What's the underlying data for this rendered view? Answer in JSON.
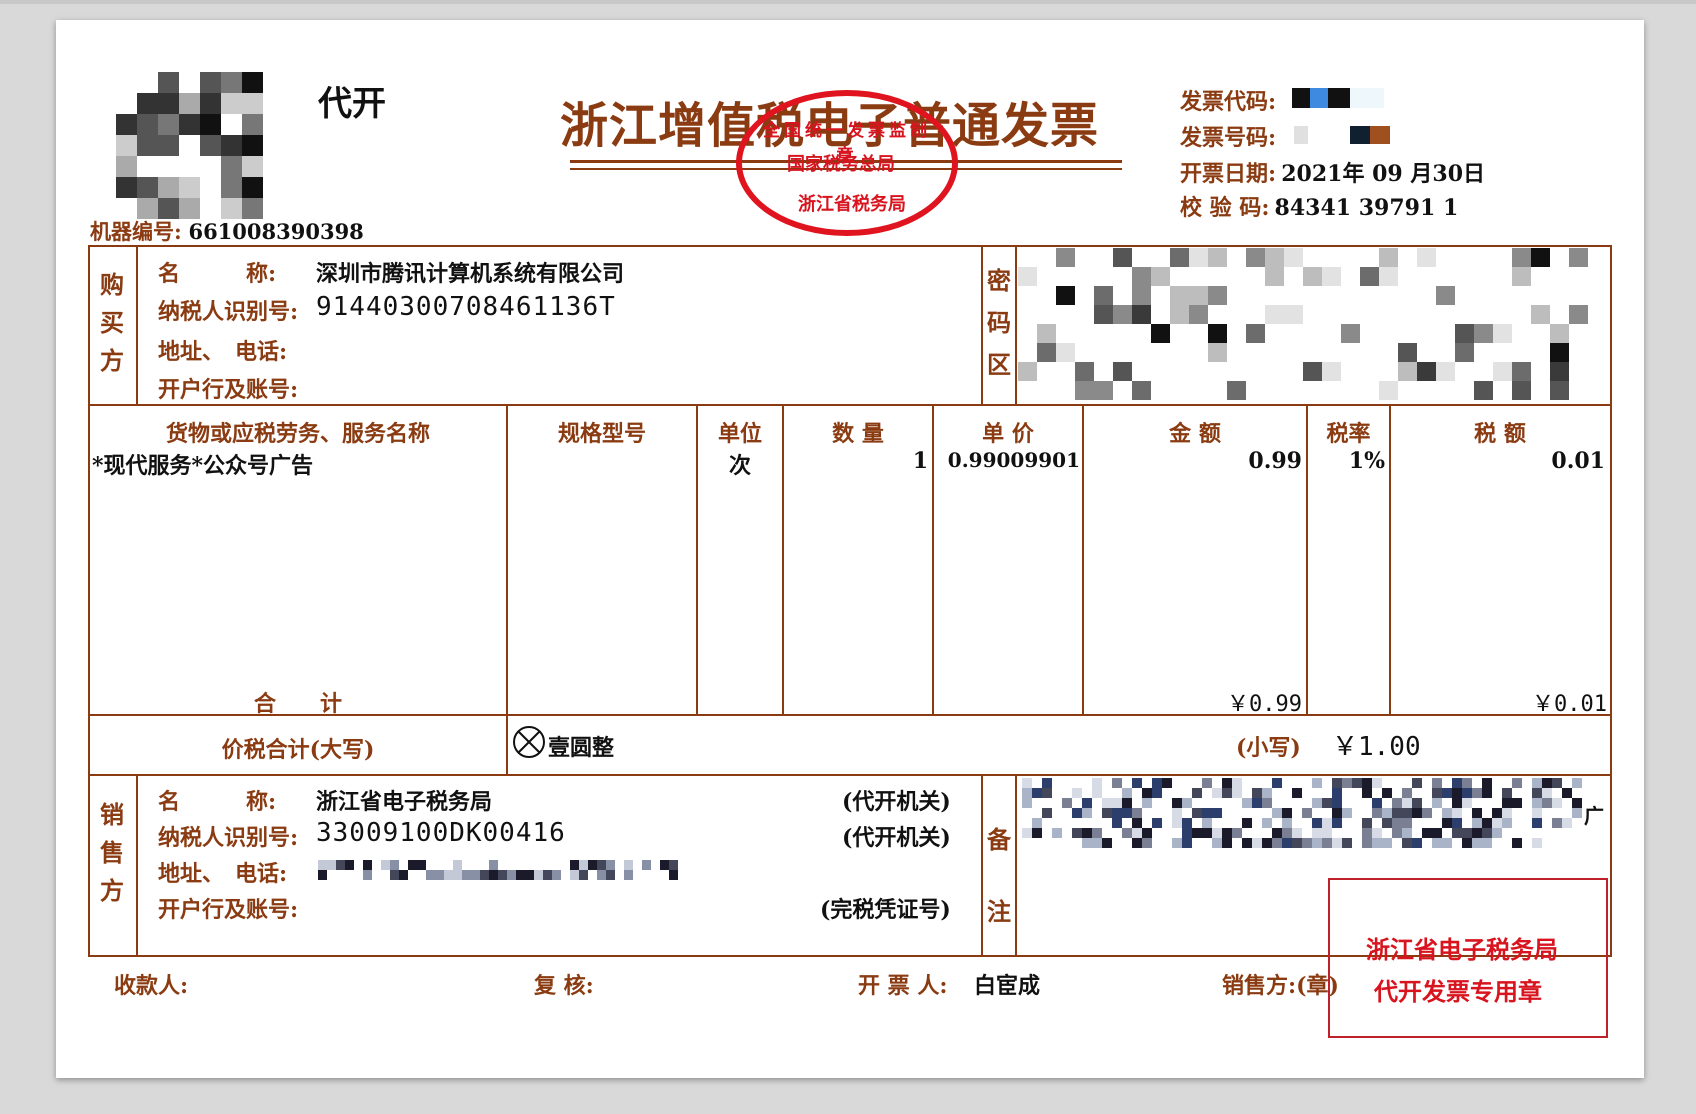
{
  "header": {
    "daikai": "代开",
    "title": "浙江增值税电子普通发票",
    "machine_label": "机器编号:",
    "machine_no": "661008390398",
    "code_label": "发票代码:",
    "number_label": "发票号码:",
    "date_label": "开票日期:",
    "date_value": "2021年 09 月30日",
    "check_label": "校 验 码:",
    "check_value": "84341 39791 1"
  },
  "stamp": {
    "line1": "国家税务总局",
    "line2": "浙江省税务局",
    "top_text": "全国统一发票监制章"
  },
  "buyer": {
    "side_label": [
      "购",
      "买",
      "方"
    ],
    "name_label": "名　　　称:",
    "name": "深圳市腾讯计算机系统有限公司",
    "taxid_label": "纳税人识别号:",
    "taxid": "91440300708461136T",
    "addr_label": "地址、　电话:",
    "bank_label": "开户行及账号:"
  },
  "cipher": {
    "side_label": [
      "密",
      "码",
      "区"
    ]
  },
  "items": {
    "headers": {
      "name": "货物或应税劳务、服务名称",
      "spec": "规格型号",
      "unit": "单位",
      "qty": "数 量",
      "price": "单 价",
      "amount": "金 额",
      "rate": "税率",
      "tax": "税 额"
    },
    "row": {
      "name": "*现代服务*公众号广告",
      "unit": "次",
      "qty": "1",
      "price": "0.99009901",
      "amount": "0.99",
      "rate": "1%",
      "tax": "0.01"
    },
    "total_label": "合　　计",
    "total_amount": "￥0.99",
    "total_tax": "￥0.01"
  },
  "sum": {
    "label": "价税合计(大写)",
    "upper_value": "壹圆整",
    "lower_label": "(小写)",
    "lower_value": "￥1.00"
  },
  "seller": {
    "side_label": [
      "销",
      "售",
      "方"
    ],
    "name_label": "名　　　称:",
    "name": "浙江省电子税务局",
    "taxid_label": "纳税人识别号:",
    "taxid": "33009100DK00416",
    "addr_label": "地址、　电话:",
    "bank_label": "开户行及账号:",
    "agent1": "(代开机关)",
    "agent2": "(代开机关)",
    "agent3": "(完税凭证号)"
  },
  "remark": {
    "side_label": [
      "备",
      "注"
    ],
    "trailing": "广"
  },
  "footer": {
    "payee_label": "收款人:",
    "review_label": "复 核:",
    "issuer_label": "开 票 人:",
    "issuer": "白宦成",
    "seller_label": "销售方:(章)"
  },
  "seal": {
    "line1": "浙江省电子税务局",
    "line2": "代开发票专用章"
  },
  "colors": {
    "frame": "#8a3b12",
    "stamp": "#e0141e"
  }
}
